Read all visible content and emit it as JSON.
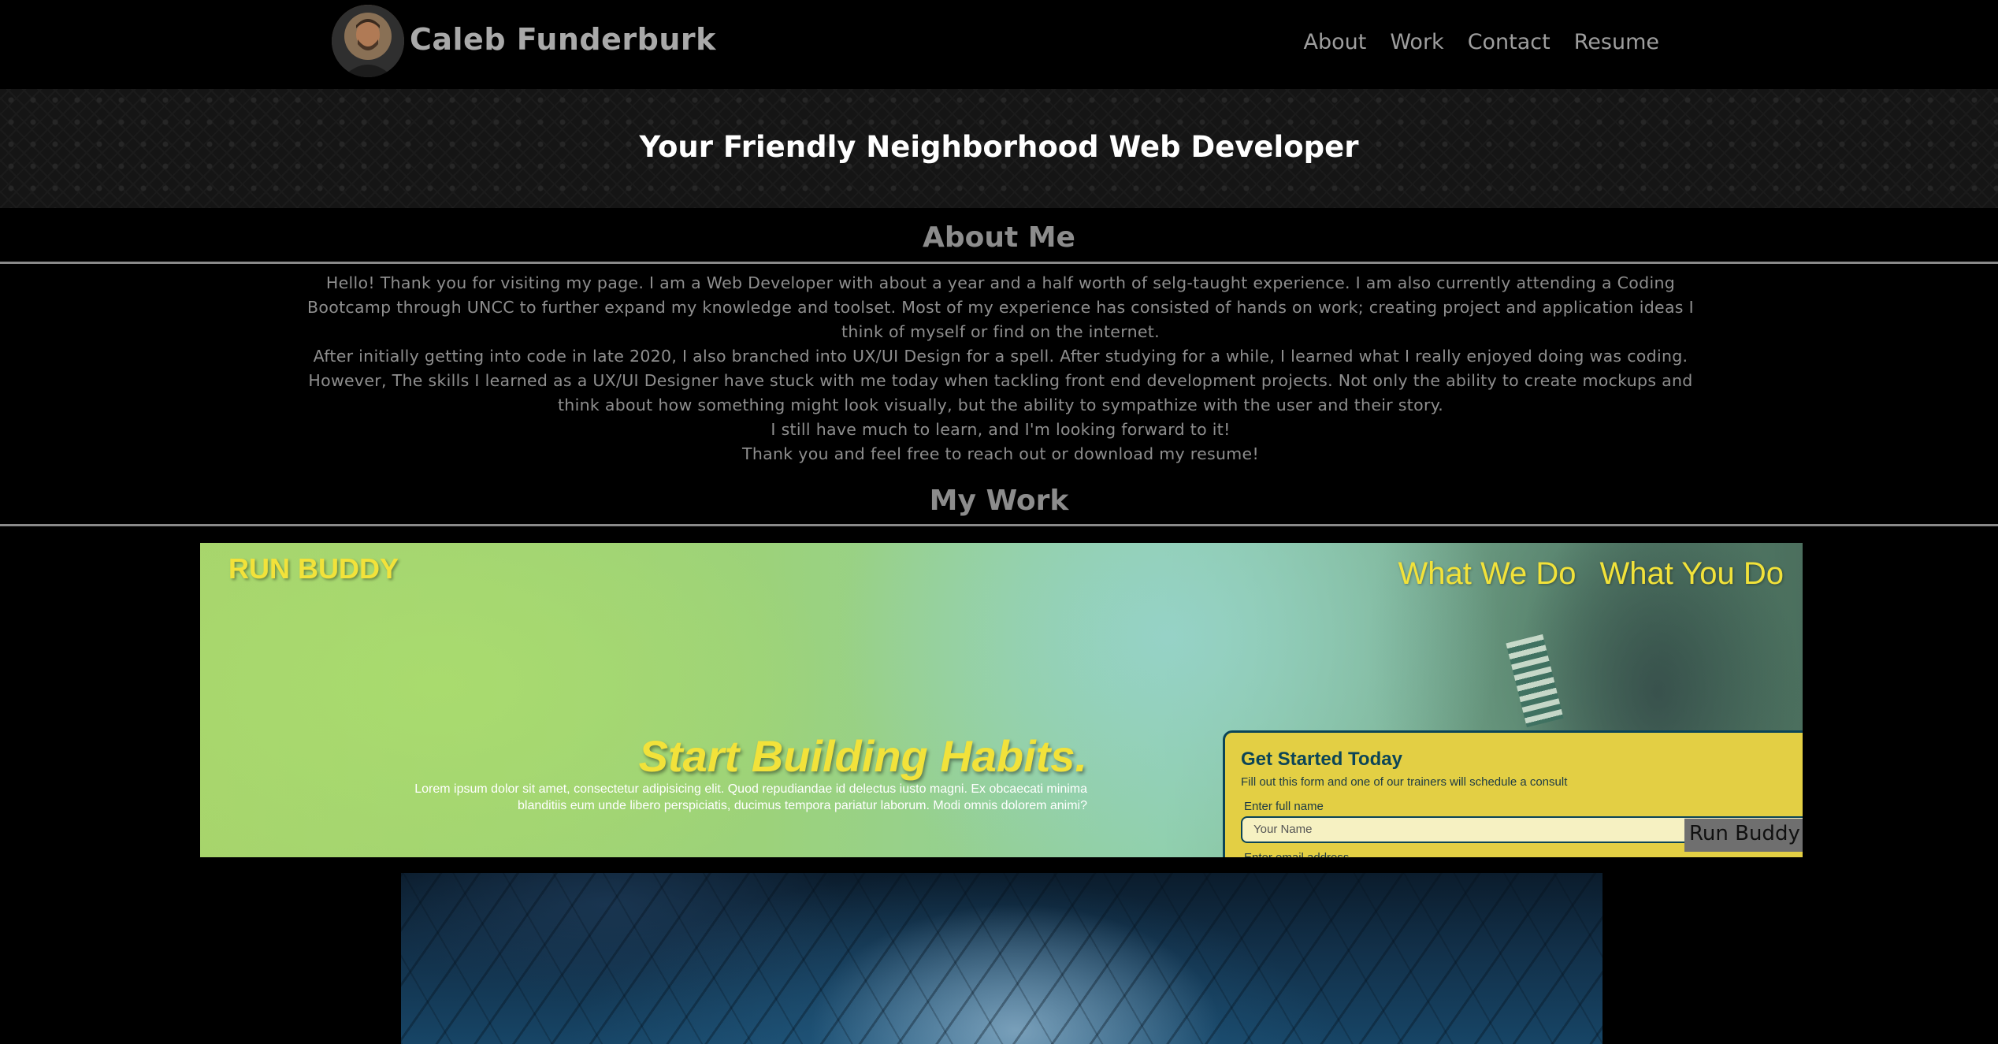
{
  "header": {
    "site_name": "Caleb Funderburk",
    "nav": [
      "About",
      "Work",
      "Contact",
      "Resume"
    ]
  },
  "hero": {
    "title": "Your Friendly Neighborhood Web Developer"
  },
  "about": {
    "heading": "About Me",
    "paragraphs": [
      "Hello! Thank you for visiting my page. I am a Web Developer with about a year and a half worth of selg-taught experience. I am also currently attending a Coding Bootcamp through UNCC to further expand my knowledge and toolset. Most of my experience has consisted of hands on work; creating project and application ideas I think of myself or find on the internet.",
      "After initially getting into code in late 2020, I also branched into UX/UI Design for a spell. After studying for a while, I learned what I really enjoyed doing was coding. However, The skills I learned as a UX/UI Designer have stuck with me today when tackling front end development projects. Not only the ability to create mockups and think about how something might look visually, but the ability to sympathize with the user and their story.",
      "I still have much to learn, and I'm looking forward to it!",
      "Thank you and feel free to reach out or download my resume!"
    ]
  },
  "work": {
    "heading": "My Work",
    "projects": [
      {
        "caption": "Run Buddy",
        "preview": {
          "logo": "RUN BUDDY",
          "nav": [
            "What We Do",
            "What You Do"
          ],
          "headline": "Start Building Habits.",
          "body": "Lorem ipsum dolor sit amet, consectetur adipisicing elit. Quod repudiandae id delectus iusto magni. Ex obcaecati minima blanditiis eum unde libero perspiciatis, ducimus tempora pariatur laborum. Modi omnis dolorem animi?",
          "form_title": "Get Started Today",
          "form_subtitle": "Fill out this form and one of our trainers will schedule a consult",
          "form_label_name": "Enter full name",
          "form_placeholder_name": "Your Name",
          "form_label_email": "Enter email address"
        },
        "colors": {
          "accent": "#f2e23a",
          "form_bg": "#e3cf44",
          "form_border": "#0c4557"
        }
      },
      {
        "caption": ""
      }
    ]
  },
  "colors": {
    "background": "#000000",
    "heading_gray": "#8c8c8c",
    "text_gray": "#8e8e8e",
    "nav_gray": "#9e9e9e"
  }
}
